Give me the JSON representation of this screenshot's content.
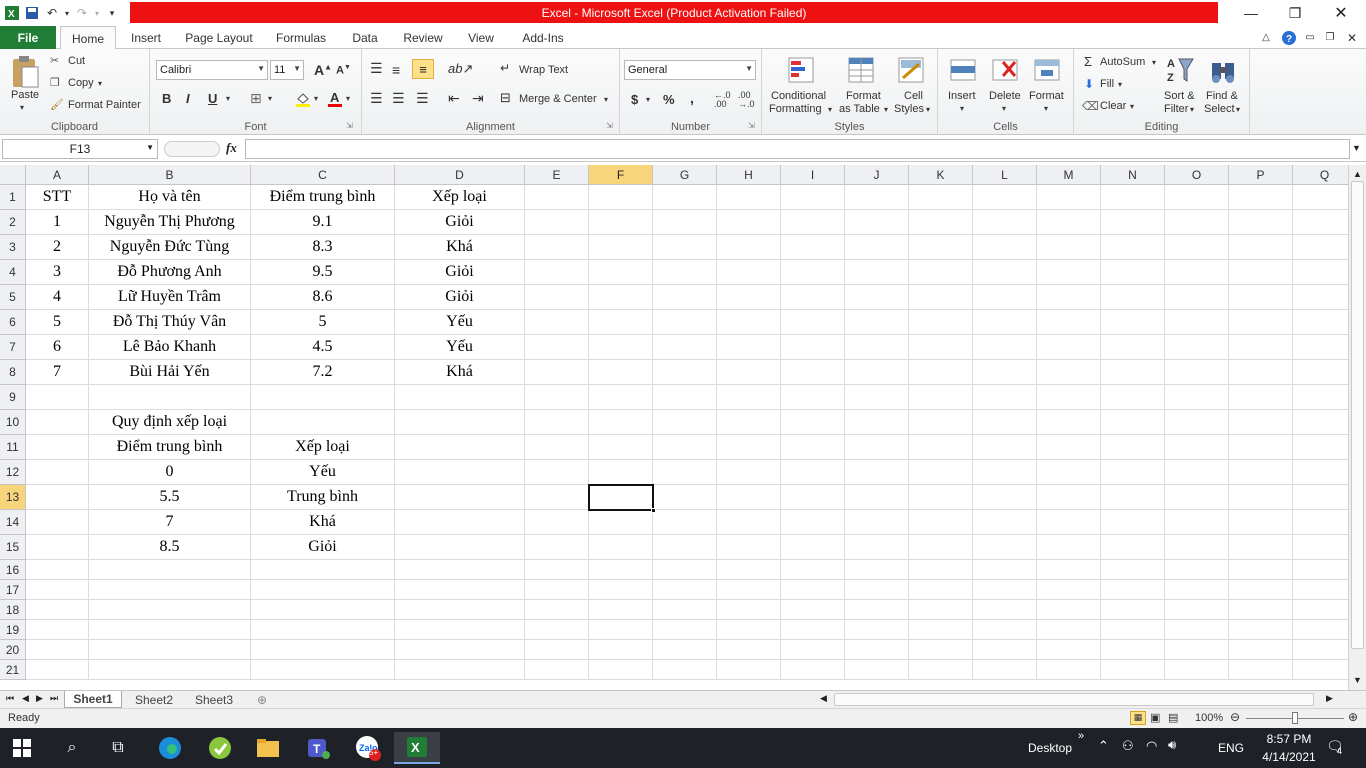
{
  "window": {
    "title": "Excel  -  Microsoft Excel (Product Activation Failed)"
  },
  "tabs": [
    "File",
    "Home",
    "Insert",
    "Page Layout",
    "Formulas",
    "Data",
    "Review",
    "View",
    "Add-Ins"
  ],
  "ribbon": {
    "clipboard": {
      "label": "Clipboard",
      "paste": "Paste",
      "cut": "Cut",
      "copy": "Copy",
      "format_painter": "Format Painter"
    },
    "font": {
      "label": "Font",
      "font_name": "Calibri",
      "font_size": "11"
    },
    "alignment": {
      "label": "Alignment",
      "wrap_text": "Wrap Text",
      "merge_center": "Merge & Center"
    },
    "number": {
      "label": "Number",
      "format": "General",
      "currency": "$",
      "percent": "%",
      "comma": ","
    },
    "styles": {
      "label": "Styles",
      "conditional": "Conditional",
      "conditional2": "Formatting",
      "format_table": "Format",
      "format_table2": "as Table",
      "cell_styles": "Cell",
      "cell_styles2": "Styles"
    },
    "cells": {
      "label": "Cells",
      "insert": "Insert",
      "delete": "Delete",
      "format": "Format"
    },
    "editing": {
      "label": "Editing",
      "autosum": "AutoSum",
      "fill": "Fill",
      "clear": "Clear",
      "sort": "Sort &",
      "sort2": "Filter",
      "find": "Find &",
      "find2": "Select"
    }
  },
  "formula_bar": {
    "name_box": "F13",
    "fx": "fx",
    "value": ""
  },
  "columns": [
    "A",
    "B",
    "C",
    "D",
    "E",
    "F",
    "G",
    "H",
    "I",
    "J",
    "K",
    "L",
    "M",
    "N",
    "O",
    "P",
    "Q"
  ],
  "rows": [
    "1",
    "2",
    "3",
    "4",
    "5",
    "6",
    "7",
    "8",
    "9",
    "10",
    "11",
    "12",
    "13",
    "14",
    "15",
    "16",
    "17",
    "18",
    "19",
    "20",
    "21"
  ],
  "table": {
    "headers": [
      "STT",
      "Họ và tên",
      "Điểm trung bình",
      "Xếp loại"
    ],
    "rows": [
      [
        "1",
        "Nguyễn Thị Phương",
        "9.1",
        "Giỏi"
      ],
      [
        "2",
        "Nguyễn Đức Tùng",
        "8.3",
        "Khá"
      ],
      [
        "3",
        "Đỗ Phương Anh",
        "9.5",
        "Giỏi"
      ],
      [
        "4",
        "Lữ Huyền Trâm",
        "8.6",
        "Giỏi"
      ],
      [
        "5",
        "Đỗ Thị Thúy Vân",
        "5",
        "Yếu"
      ],
      [
        "6",
        "Lê Bảo Khanh",
        "4.5",
        "Yếu"
      ],
      [
        "7",
        "Bùi Hải Yến",
        "7.2",
        "Khá"
      ]
    ]
  },
  "rules": {
    "title": "Quy định xếp loại",
    "headers": [
      "Điểm trung bình",
      "Xếp loại"
    ],
    "rows": [
      [
        "0",
        "Yếu"
      ],
      [
        "5.5",
        "Trung bình"
      ],
      [
        "7",
        "Khá"
      ],
      [
        "8.5",
        "Giỏi"
      ]
    ]
  },
  "sheets": [
    "Sheet1",
    "Sheet2",
    "Sheet3"
  ],
  "status": {
    "ready": "Ready",
    "zoom": "100%"
  },
  "taskbar": {
    "desktop": "Desktop",
    "lang": "ENG",
    "time": "8:57 PM",
    "date": "4/14/2021",
    "notifications": "4",
    "zalo_badge": "5+"
  },
  "colors": {
    "title_red": "#ee1111",
    "file_green": "#1f7d35",
    "selected_header": "#f8d47a"
  }
}
